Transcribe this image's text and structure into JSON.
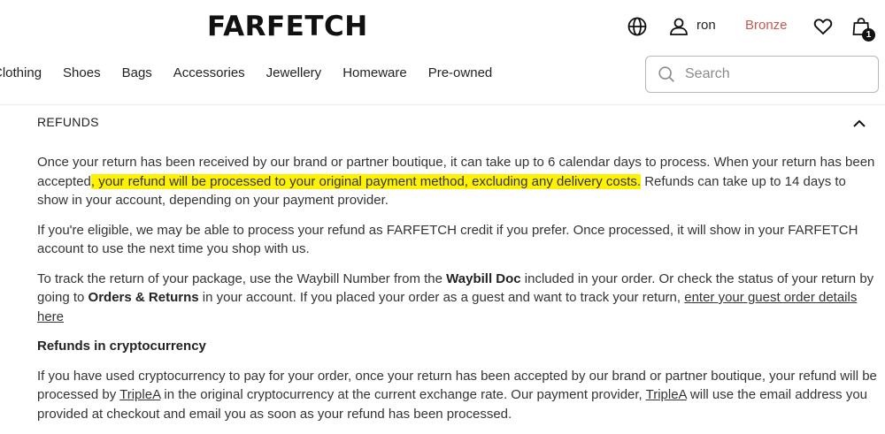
{
  "header": {
    "logo": "FARFETCH",
    "user_name": "ron",
    "tier": "Bronze",
    "bag_count": "1",
    "icons": [
      "globe-icon",
      "user-icon",
      "heart-icon",
      "bag-icon"
    ]
  },
  "nav": {
    "items": [
      "Clothing",
      "Shoes",
      "Bags",
      "Accessories",
      "Jewellery",
      "Homeware",
      "Pre-owned"
    ]
  },
  "search": {
    "placeholder": "Search"
  },
  "section": {
    "title": "REFUNDS",
    "p1": {
      "a": "Once your return has been received by our brand or partner boutique, it can take up to 6 calendar days to process. When your return has been accepted",
      "highlight": ", your refund will be processed to your original payment method, excluding any delivery costs.",
      "b": " Refunds can take up to 14 days to show in your account, depending on your payment provider."
    },
    "p2": "If you're eligible, we may be able to process your refund as FARFETCH credit if you prefer. Once processed, it will show in your FARFETCH account to use the next time you shop with us.",
    "p3": {
      "a": "To track the return of your package, use the Waybill Number from the ",
      "bold1": "Waybill Doc",
      "b": " included in your order. Or check the status of your return by going to ",
      "bold2": "Orders & Returns",
      "c": " in your account. If you placed your order as a guest and want to track your return, ",
      "link": "enter your guest order details here"
    },
    "subheading": "Refunds in cryptocurrency",
    "p4": {
      "a": "If you have used cryptocurrency to pay for your order, once your return has been accepted by our brand or partner boutique, your refund will be processed by ",
      "link1": "TripleA",
      "b": " in the original cryptocurrency at the current exchange rate. Our payment provider, ",
      "link2": "TripleA",
      "c": " will use the email address you provided at checkout and email you as soon as your refund has been processed."
    }
  },
  "colors": {
    "highlight": "#fff200",
    "tier": "#c7584e",
    "text": "#333333"
  }
}
